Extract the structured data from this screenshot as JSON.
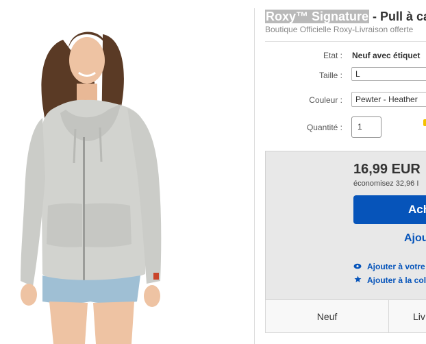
{
  "product": {
    "title_highlight": "Roxy™ Signature",
    "title_rest": " - Pull à ca",
    "subtitle": "Boutique Officielle Roxy-Livraison offerte"
  },
  "specs": {
    "condition_label": "Etat :",
    "condition_value": "Neuf avec étiquet",
    "size_label": "Taille :",
    "size_value": "L",
    "color_label": "Couleur :",
    "color_value": "Pewter - Heather",
    "quantity_label": "Quantité :",
    "quantity_value": "1"
  },
  "purchase": {
    "price": "16,99 EUR",
    "savings": "économisez 32,96 I",
    "buy_label": "Ach",
    "cart_label": "Ajou",
    "watch_label": "Ajouter à votre",
    "collection_label": "Ajouter à la col"
  },
  "tabs": {
    "new_label": "Neuf",
    "delivery_label": "Liv"
  },
  "icons": {
    "watch": "eye-icon",
    "collection": "star-icon"
  },
  "colors": {
    "accent": "#0654ba",
    "title_highlight_bg": "#b9b9b9",
    "price_box_bg": "#e8e8e8"
  }
}
